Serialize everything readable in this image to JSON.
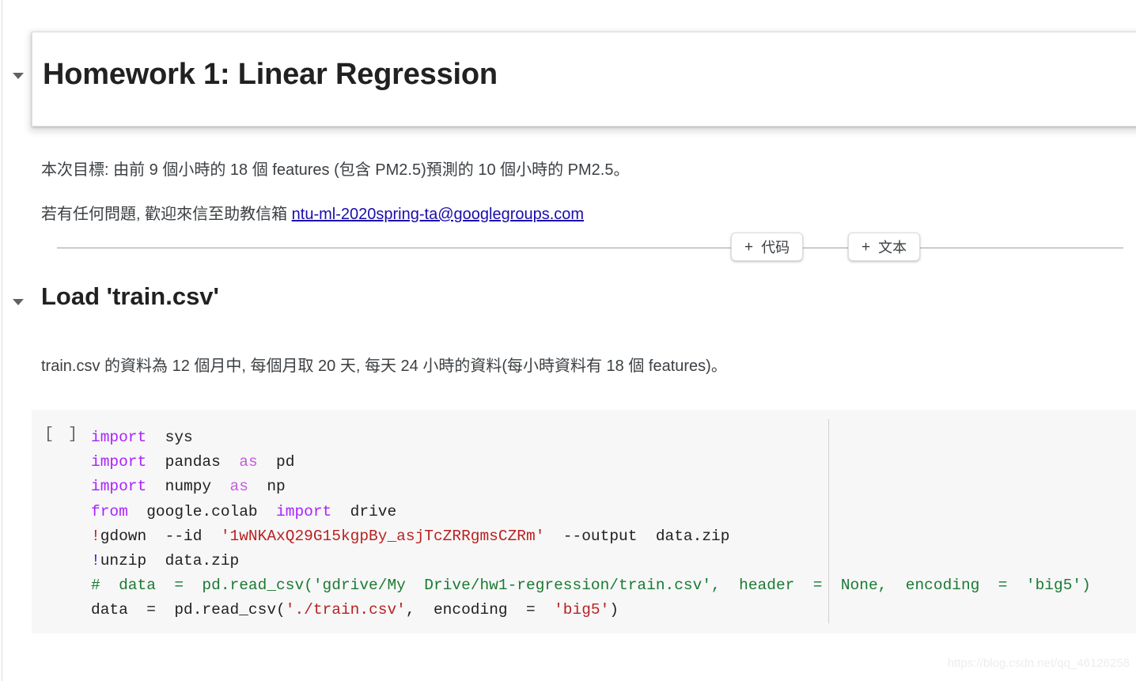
{
  "page": {
    "watermark": "https://blog.csdn.net/qq_46126258"
  },
  "title_cell": {
    "heading": "Homework 1: Linear Regression",
    "caret_icon": "triangle-down-icon"
  },
  "intro": {
    "line1_prefix": "本次目標: 由前 9 個小時的 18 個 features (包含 PM2.5)預測的 10 個小時的 PM2.5。",
    "line2_prefix": "若有任何問題, 歡迎來信至助教信箱 ",
    "email": "ntu-ml-2020spring-ta@googlegroups.com"
  },
  "insert_toolbar": {
    "code_button": "代码",
    "text_button": "文本",
    "plus_icon": "+"
  },
  "section": {
    "heading": "Load 'train.csv'",
    "caret_icon": "triangle-down-icon",
    "description": "train.csv 的資料為 12 個月中, 每個月取 20 天, 每天 24 小時的資料(每小時資料有 18 個 features)。"
  },
  "code_cell": {
    "run_indicator": "[ ]",
    "lines": [
      {
        "tokens": [
          {
            "t": "import",
            "c": "tok-kw"
          },
          {
            "t": "  sys",
            "c": "tok-plain"
          }
        ]
      },
      {
        "tokens": [
          {
            "t": "import",
            "c": "tok-kw"
          },
          {
            "t": "  pandas  ",
            "c": "tok-plain"
          },
          {
            "t": "as",
            "c": "tok-as"
          },
          {
            "t": "  pd",
            "c": "tok-plain"
          }
        ]
      },
      {
        "tokens": [
          {
            "t": "import",
            "c": "tok-kw"
          },
          {
            "t": "  numpy  ",
            "c": "tok-plain"
          },
          {
            "t": "as",
            "c": "tok-as"
          },
          {
            "t": "  np",
            "c": "tok-plain"
          }
        ]
      },
      {
        "tokens": [
          {
            "t": "from",
            "c": "tok-kw"
          },
          {
            "t": "  google.colab  ",
            "c": "tok-plain"
          },
          {
            "t": "import",
            "c": "tok-kw"
          },
          {
            "t": "  drive",
            "c": "tok-plain"
          }
        ]
      },
      {
        "tokens": [
          {
            "t": "!",
            "c": "tok-bang"
          },
          {
            "t": "gdown  --id  ",
            "c": "tok-plain"
          },
          {
            "t": "'1wNKAxQ29G15kgpBy_asjTcZRRgmsCZRm'",
            "c": "tok-str"
          },
          {
            "t": "  --output  data.zip",
            "c": "tok-plain"
          }
        ]
      },
      {
        "tokens": [
          {
            "t": "!",
            "c": "tok-bang2"
          },
          {
            "t": "unzip  data.zip",
            "c": "tok-plain"
          }
        ]
      },
      {
        "tokens": [
          {
            "t": "#  data  =  pd.read_csv('gdrive/My  Drive/hw1-regression/train.csv',  header  =  None,  encoding  =  'big5')",
            "c": "tok-cmt"
          }
        ]
      },
      {
        "tokens": [
          {
            "t": "data  =  pd.read_csv(",
            "c": "tok-plain"
          },
          {
            "t": "'./train.csv'",
            "c": "tok-str"
          },
          {
            "t": ",  encoding  =  ",
            "c": "tok-plain"
          },
          {
            "t": "'big5'",
            "c": "tok-str"
          },
          {
            "t": ")",
            "c": "tok-plain"
          }
        ]
      }
    ]
  }
}
